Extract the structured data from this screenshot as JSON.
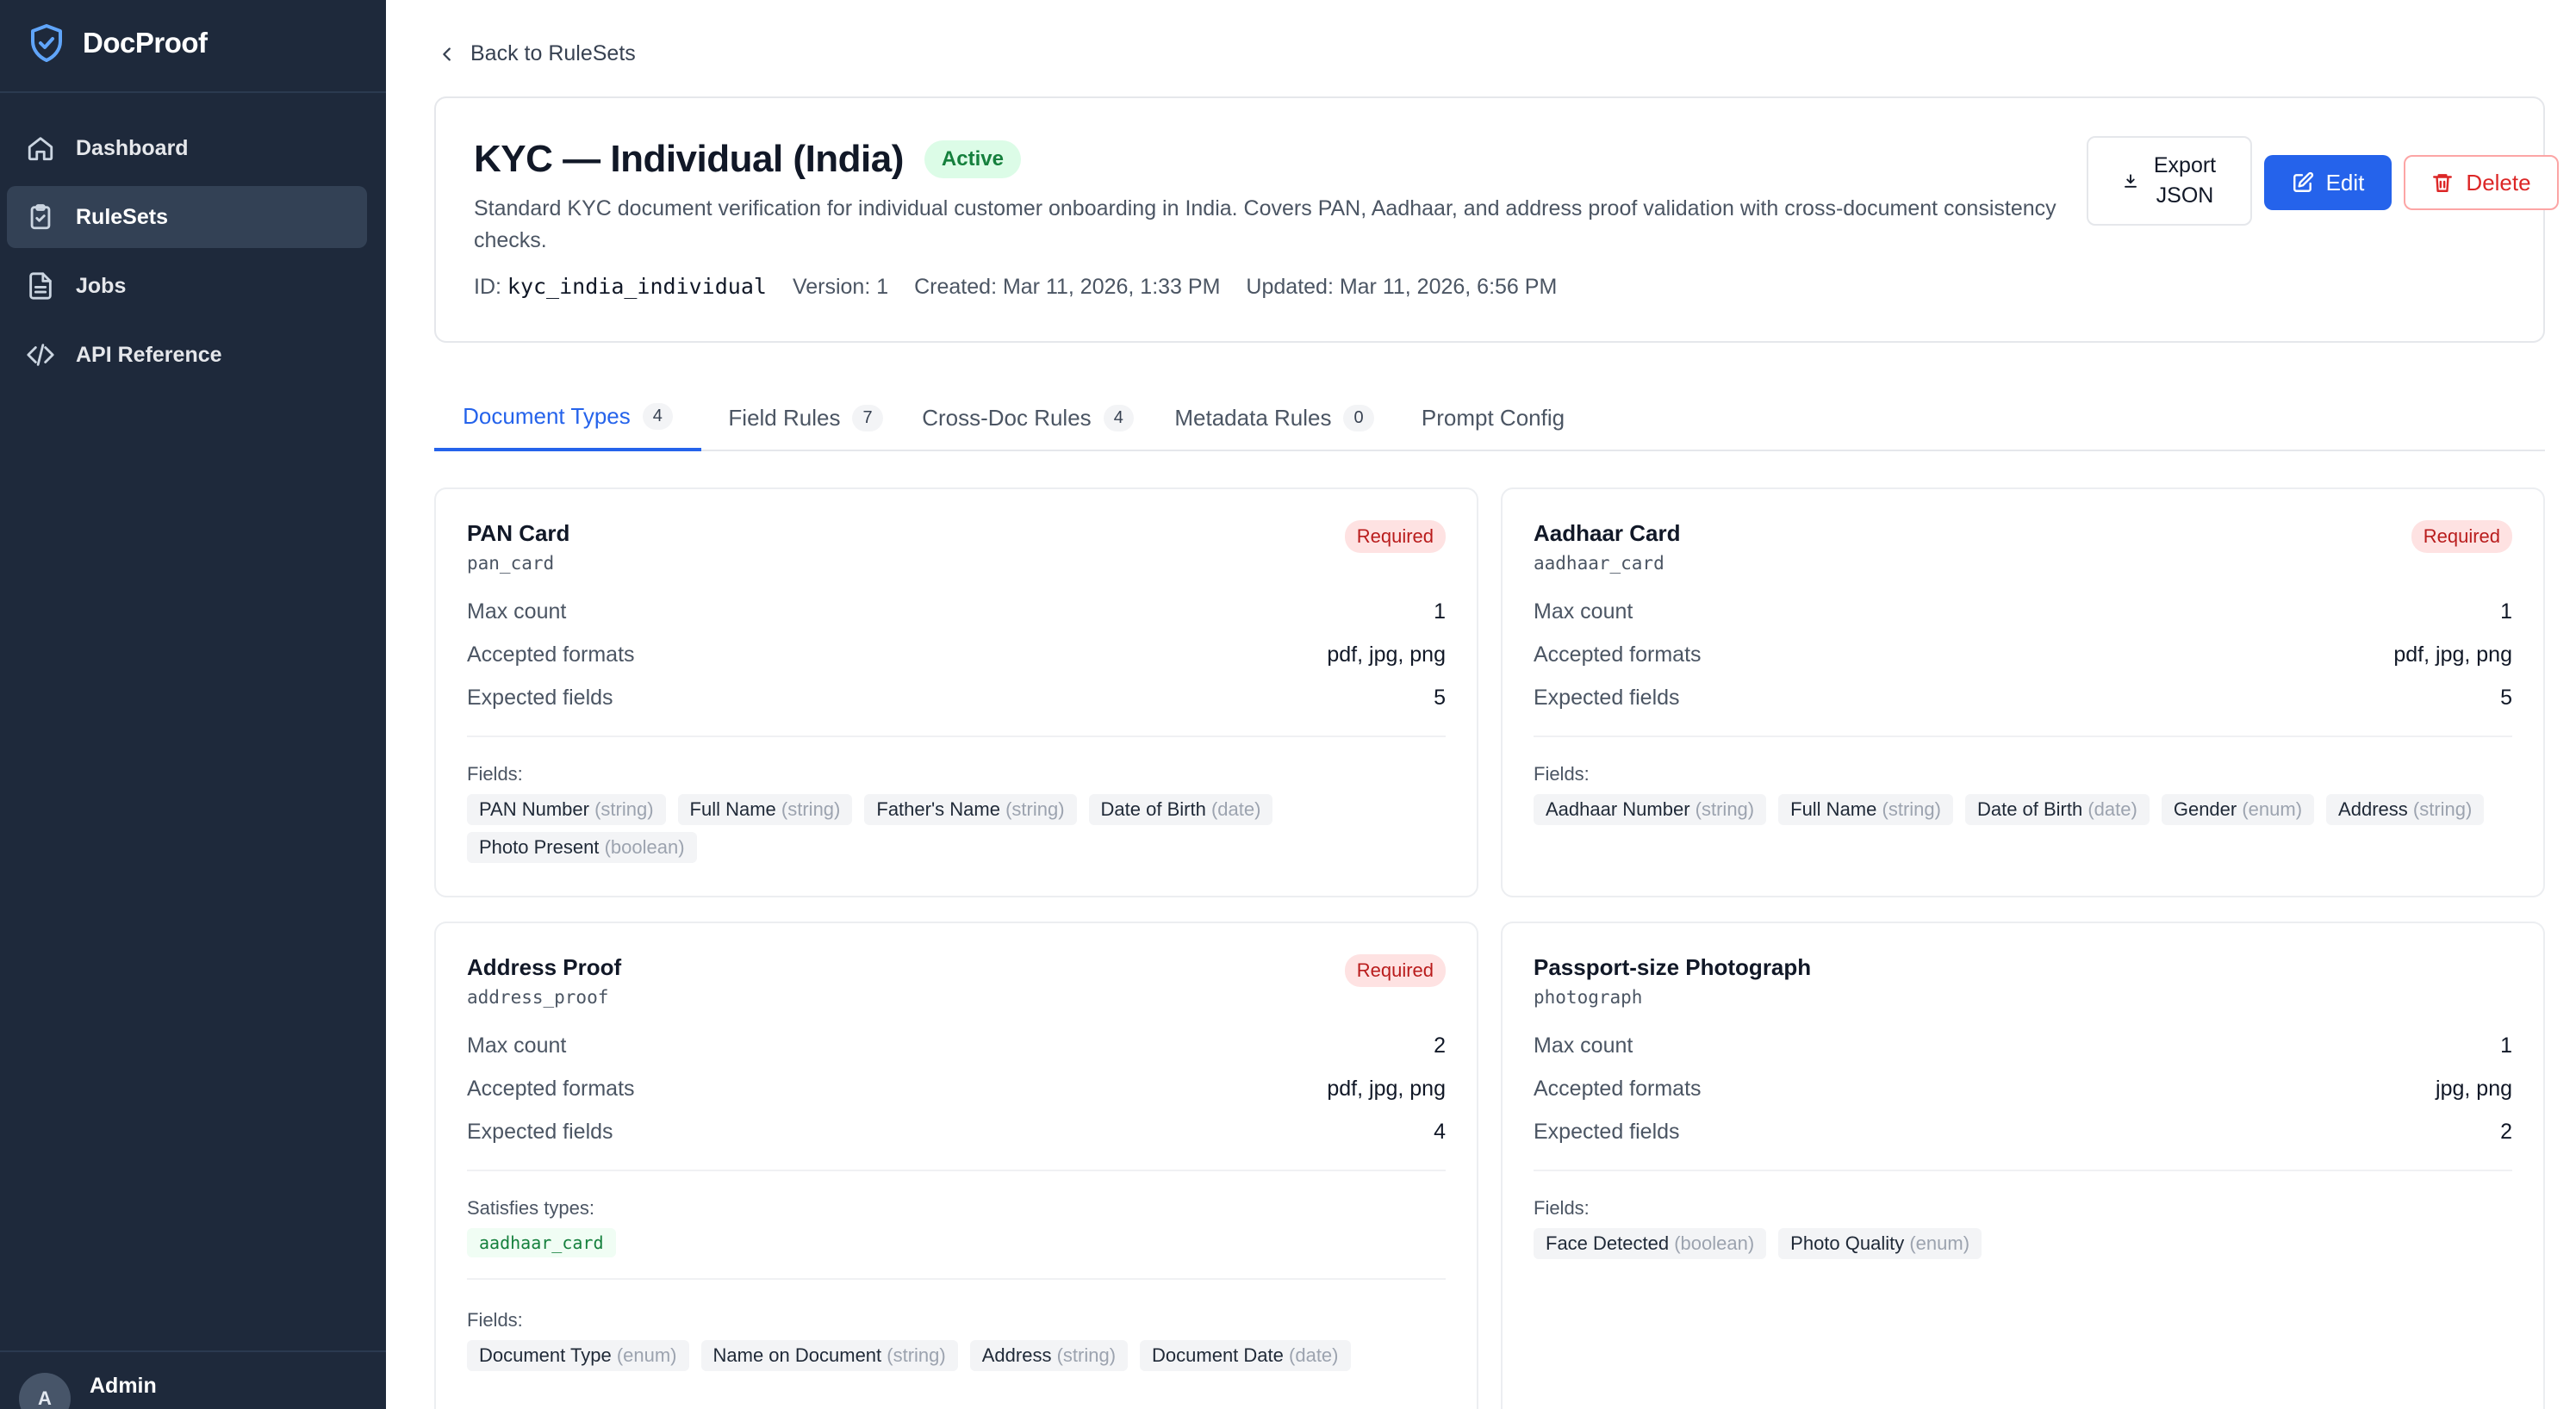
{
  "brand": {
    "name": "DocProof"
  },
  "nav": {
    "items": [
      {
        "label": "Dashboard",
        "icon": "home-icon"
      },
      {
        "label": "RuleSets",
        "icon": "clipboard-icon",
        "active": true
      },
      {
        "label": "Jobs",
        "icon": "file-icon"
      },
      {
        "label": "API Reference",
        "icon": "code-icon"
      }
    ]
  },
  "user": {
    "name": "Admin",
    "initial": "A"
  },
  "back_link": "Back to RuleSets",
  "ruleset": {
    "title": "KYC — Individual (India)",
    "status": "Active",
    "description": "Standard KYC document verification for individual customer onboarding in India. Covers PAN, Aadhaar, and address proof validation with cross-document consistency checks.",
    "id_label": "ID:",
    "id_value": "kyc_india_individual",
    "version": "Version: 1",
    "created": "Created: Mar 11, 2026, 1:33 PM",
    "updated": "Updated: Mar 11, 2026, 6:56 PM"
  },
  "actions": {
    "export_line1": "Export",
    "export_line2": "JSON",
    "edit": "Edit",
    "delete": "Delete"
  },
  "tabs": [
    {
      "label": "Document Types",
      "count": "4",
      "active": true
    },
    {
      "label": "Field Rules",
      "count": "7"
    },
    {
      "label": "Cross-Doc Rules",
      "count": "4"
    },
    {
      "label": "Metadata Rules",
      "count": "0"
    },
    {
      "label": "Prompt Config",
      "count": ""
    }
  ],
  "labels": {
    "max_count": "Max count",
    "accepted_formats": "Accepted formats",
    "expected_fields": "Expected fields",
    "fields": "Fields:",
    "satisfies_types": "Satisfies types:",
    "required": "Required"
  },
  "cards": [
    {
      "name": "PAN Card",
      "id": "pan_card",
      "required": true,
      "max_count": "1",
      "accepted_formats": "pdf, jpg, png",
      "expected_fields": "5",
      "fields": [
        {
          "name": "PAN Number",
          "type": "(string)"
        },
        {
          "name": "Full Name",
          "type": "(string)"
        },
        {
          "name": "Father's Name",
          "type": "(string)"
        },
        {
          "name": "Date of Birth",
          "type": "(date)"
        },
        {
          "name": "Photo Present",
          "type": "(boolean)"
        }
      ]
    },
    {
      "name": "Aadhaar Card",
      "id": "aadhaar_card",
      "required": true,
      "max_count": "1",
      "accepted_formats": "pdf, jpg, png",
      "expected_fields": "5",
      "fields": [
        {
          "name": "Aadhaar Number",
          "type": "(string)"
        },
        {
          "name": "Full Name",
          "type": "(string)"
        },
        {
          "name": "Date of Birth",
          "type": "(date)"
        },
        {
          "name": "Gender",
          "type": "(enum)"
        },
        {
          "name": "Address",
          "type": "(string)"
        }
      ]
    },
    {
      "name": "Address Proof",
      "id": "address_proof",
      "required": true,
      "max_count": "2",
      "accepted_formats": "pdf, jpg, png",
      "expected_fields": "4",
      "satisfies": [
        "aadhaar_card"
      ],
      "fields": [
        {
          "name": "Document Type",
          "type": "(enum)"
        },
        {
          "name": "Name on Document",
          "type": "(string)"
        },
        {
          "name": "Address",
          "type": "(string)"
        },
        {
          "name": "Document Date",
          "type": "(date)"
        }
      ]
    },
    {
      "name": "Passport-size Photograph",
      "id": "photograph",
      "required": false,
      "max_count": "1",
      "accepted_formats": "jpg, png",
      "expected_fields": "2",
      "fields": [
        {
          "name": "Face Detected",
          "type": "(boolean)"
        },
        {
          "name": "Photo Quality",
          "type": "(enum)"
        }
      ]
    }
  ],
  "colors": {
    "sidebar_bg": "#1e293b",
    "accent": "#2563eb",
    "active_badge_bg": "#dcfce7",
    "required_badge_bg": "#fee2e2",
    "danger": "#dc2626"
  }
}
